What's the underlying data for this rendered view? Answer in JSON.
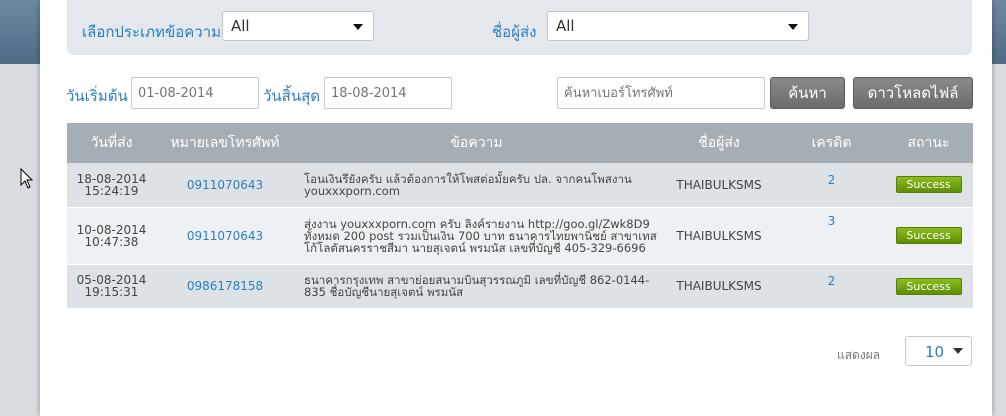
{
  "filters": {
    "type_label": "เลือกประเภทข้อความ",
    "type_value": "All",
    "sender_label": "ชื่อผู้ส่ง",
    "sender_value": "All"
  },
  "dates": {
    "start_label": "วันเริ่มต้น",
    "start_placeholder": "01-08-2014",
    "end_label": "วันสิ้นสุด",
    "end_placeholder": "18-08-2014"
  },
  "search": {
    "placeholder": "ค้นหาเบอร์โทรศัพท์",
    "search_button": "ค้นหา",
    "download_button": "ดาวโหลดไฟล์"
  },
  "table": {
    "headers": [
      "วันที่ส่ง",
      "หมายเลขโทรศัพท์",
      "ข้อความ",
      "ชื่อผู้ส่ง",
      "เครดิต",
      "สถานะ"
    ],
    "rows": [
      {
        "date": "18-08-2014",
        "time": "15:24:19",
        "phone": "0911070643",
        "message": "โอนเงินรึยังครับ แล้วต้องการให้โพสต่อมั้ยครับ ปล. จากคนโพสงาน youxxxporn.com",
        "sender": "THAIBULKSMS",
        "credit": "2",
        "status": "Success"
      },
      {
        "date": "10-08-2014",
        "time": "10:47:38",
        "phone": "0911070643",
        "message": "ส่งงาน youxxxporn.com ครับ ลิงค์รายงาน http://goo.gl/Zwk8D9 ทั้งหมด 200 post รวมเป็นเงิน 700 บาท ธนาคารไทยพานิชย์ สาขาเทสโก้โลตัสนครราชสีมา นายสุเจตน์ พรมนัส เลขที่บัญชี 405-329-6696",
        "sender": "THAIBULKSMS",
        "credit": "3",
        "status": "Success"
      },
      {
        "date": "05-08-2014",
        "time": "19:15:31",
        "phone": "0986178158",
        "message": "ธนาคารกรุงเทพ สาขาย่อยสนามบินสุวรรณภูมิ เลขที่บัญชี 862-0144-835 ชื่อบัญชีนายสุเจตน์ พรมนัส",
        "sender": "THAIBULKSMS",
        "credit": "2",
        "status": "Success"
      }
    ]
  },
  "pagination": {
    "show_label": "แสดงผล",
    "page_size": "10"
  },
  "colors": {
    "accent": "#2a7fc1",
    "success": "#6f9e0e"
  }
}
